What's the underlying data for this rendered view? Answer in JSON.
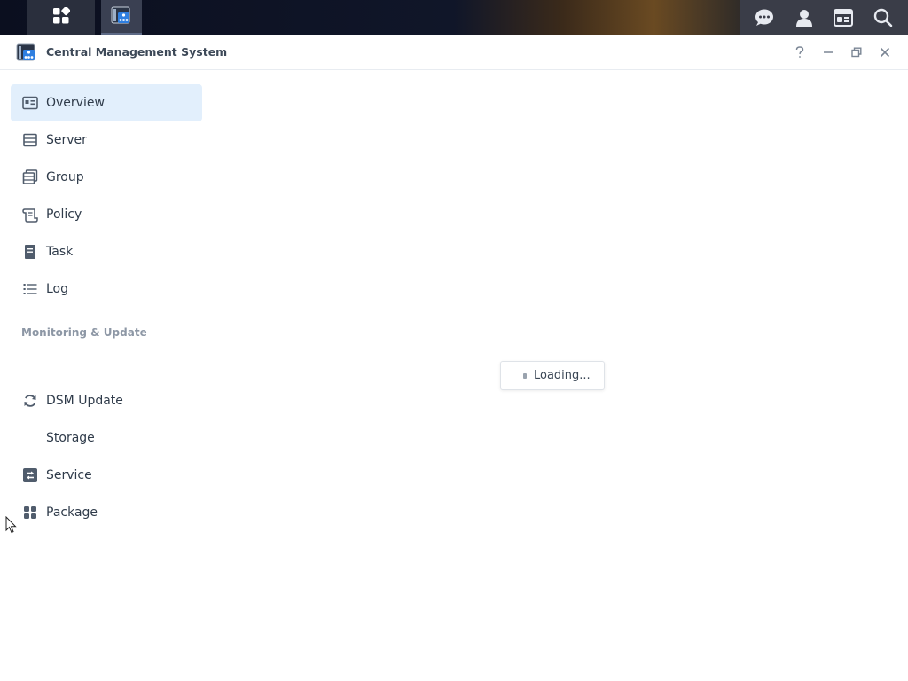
{
  "taskbar": {
    "items": [
      {
        "name": "main-menu",
        "icon": "grid-icon"
      },
      {
        "name": "central-management-system",
        "icon": "cms-app-icon"
      }
    ],
    "right_icons": [
      "chat-icon",
      "user-icon",
      "widgets-icon",
      "search-icon"
    ]
  },
  "window": {
    "title": "Central Management System",
    "controls": [
      "help-icon",
      "minimize-icon",
      "restore-icon",
      "close-icon"
    ]
  },
  "sidebar": {
    "items": [
      {
        "label": "Overview",
        "icon": "overview-icon",
        "active": true
      },
      {
        "label": "Server",
        "icon": "server-icon",
        "active": false
      },
      {
        "label": "Group",
        "icon": "group-icon",
        "active": false
      },
      {
        "label": "Policy",
        "icon": "policy-icon",
        "active": false
      },
      {
        "label": "Task",
        "icon": "task-icon",
        "active": false
      },
      {
        "label": "Log",
        "icon": "log-icon",
        "active": false
      }
    ],
    "section_title": "Monitoring & Update",
    "section_items": [
      {
        "label": "DSM Update",
        "icon": "refresh-icon"
      },
      {
        "label": "Storage",
        "icon": ""
      },
      {
        "label": "Service",
        "icon": "service-icon"
      },
      {
        "label": "Package",
        "icon": "package-icon"
      }
    ]
  },
  "main": {
    "loading_text": "Loading..."
  },
  "colors": {
    "accent": "#e2effc",
    "text": "#2f3b4a",
    "muted": "#8d97a5"
  }
}
